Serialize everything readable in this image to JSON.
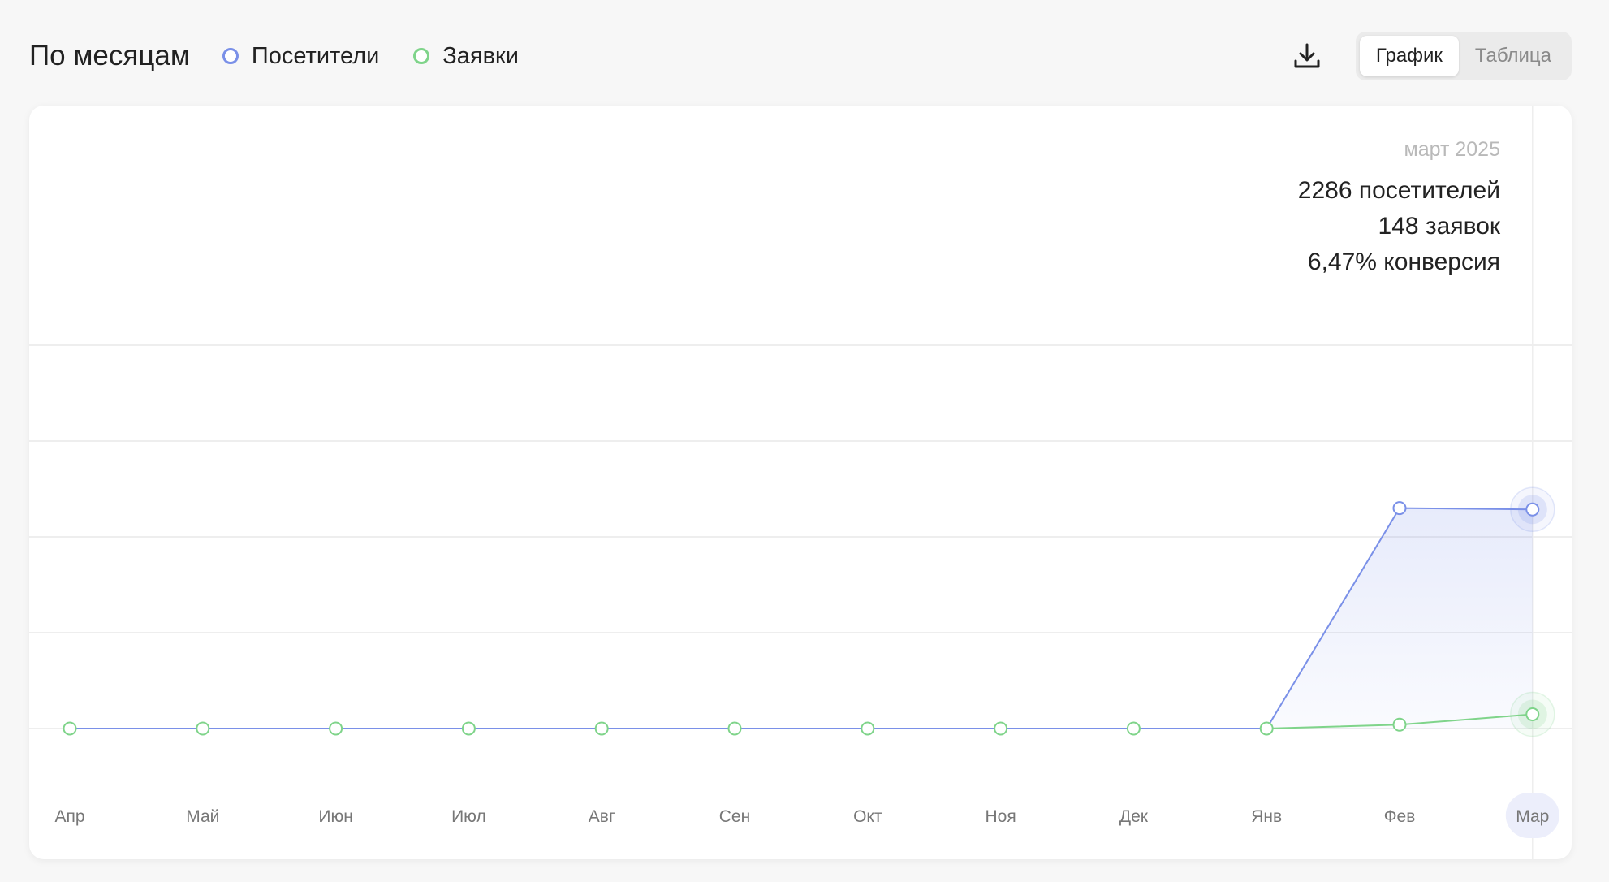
{
  "header": {
    "title": "По месяцам",
    "legend": [
      {
        "label": "Посетители",
        "color": "#7a90e8"
      },
      {
        "label": "Заявки",
        "color": "#7fd48a"
      }
    ],
    "download_icon": "download-icon",
    "view_toggle": {
      "chart_label": "График",
      "table_label": "Таблица",
      "active": "chart"
    }
  },
  "tooltip": {
    "date": "март 2025",
    "visitors": "2286 посетителей",
    "requests": "148 заявок",
    "conversion": "6,47% конверсия"
  },
  "chart_data": {
    "type": "line",
    "categories": [
      "Апр",
      "Май",
      "Июн",
      "Июл",
      "Авг",
      "Сен",
      "Окт",
      "Ноя",
      "Дек",
      "Янв",
      "Фев",
      "Мар"
    ],
    "series": [
      {
        "name": "Посетители",
        "color": "#7a90e8",
        "values": [
          0,
          0,
          0,
          0,
          0,
          0,
          0,
          0,
          0,
          0,
          2300,
          2286
        ],
        "area": true
      },
      {
        "name": "Заявки",
        "color": "#7fd48a",
        "values": [
          0,
          0,
          0,
          0,
          0,
          0,
          0,
          0,
          0,
          0,
          40,
          148
        ]
      }
    ],
    "ylim": [
      0,
      4000
    ],
    "grid": true,
    "highlighted_category": "Мар"
  }
}
